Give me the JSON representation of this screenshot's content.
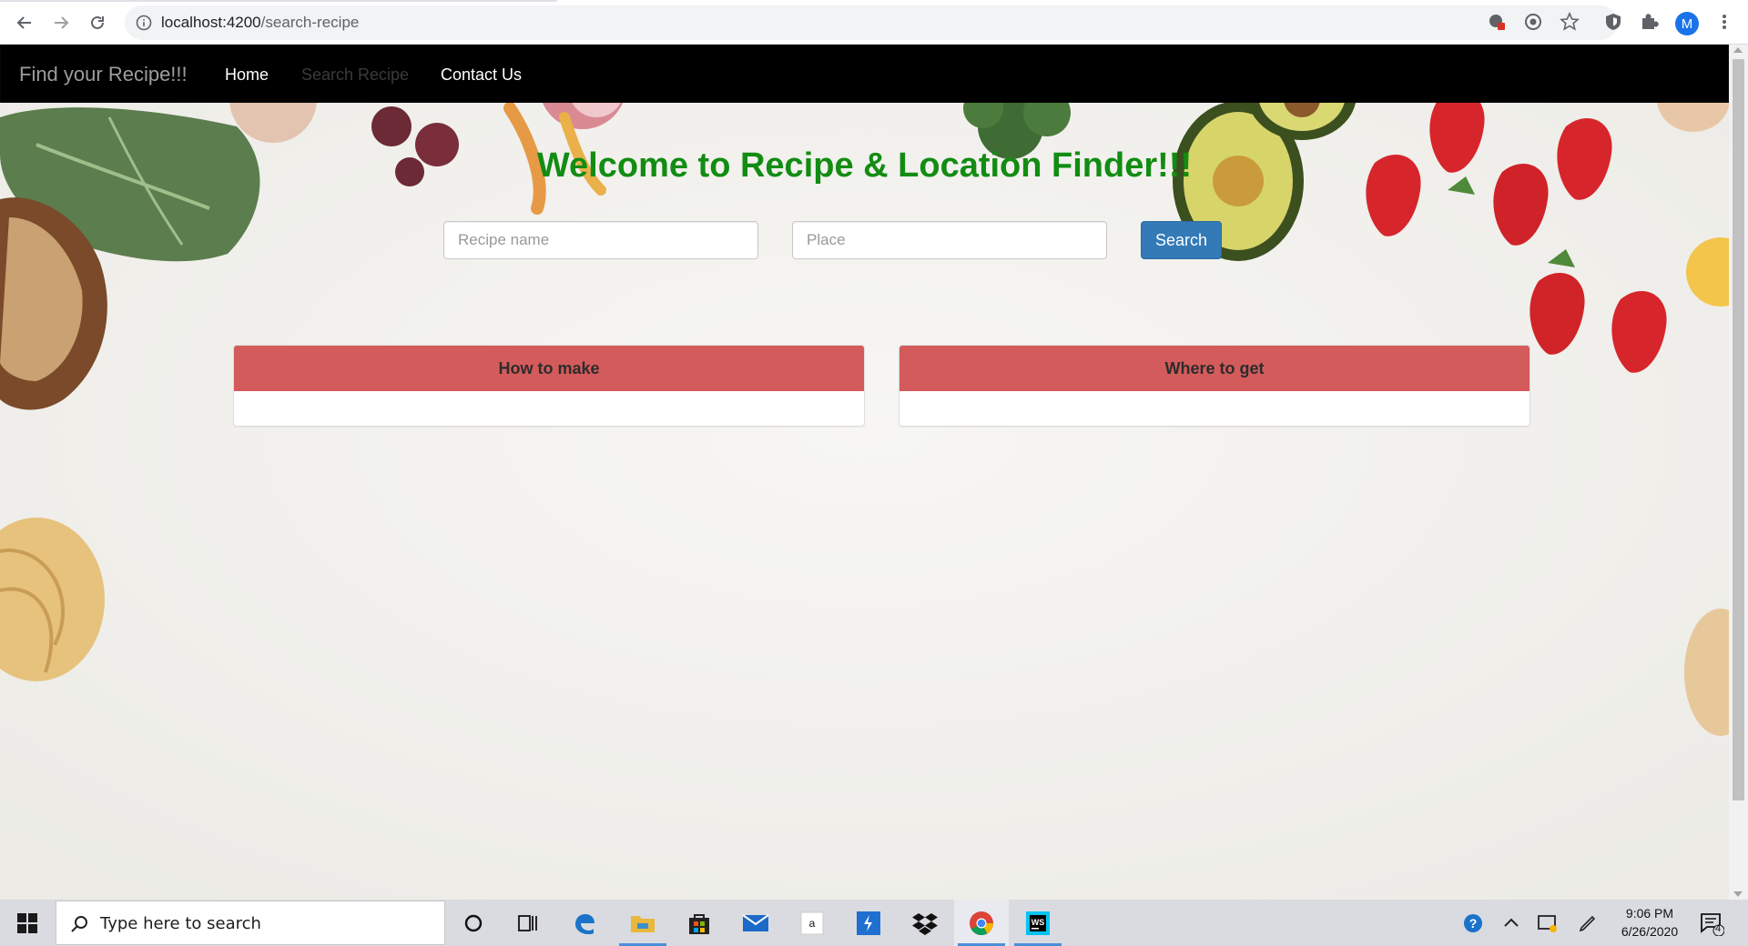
{
  "browser": {
    "url_host": "localhost:4200",
    "url_path": "/search-recipe",
    "profile_initial": "M"
  },
  "navbar": {
    "brand": "Find your Recipe!!!",
    "links": [
      {
        "label": "Home"
      },
      {
        "label": "Search Recipe"
      },
      {
        "label": "Contact Us"
      }
    ]
  },
  "main": {
    "heading": "Welcome to Recipe & Location Finder!!!",
    "recipe_placeholder": "Recipe name",
    "place_placeholder": "Place",
    "search_label": "Search",
    "panels": [
      {
        "title": "How to make"
      },
      {
        "title": "Where to get"
      }
    ]
  },
  "taskbar": {
    "search_placeholder": "Type here to search",
    "time": "9:06 PM",
    "date": "6/26/2020",
    "notification_count": "4"
  },
  "colors": {
    "heading": "#128c12",
    "panel_header": "#d45b5b",
    "button": "#337ab7",
    "navbar": "#000000"
  }
}
